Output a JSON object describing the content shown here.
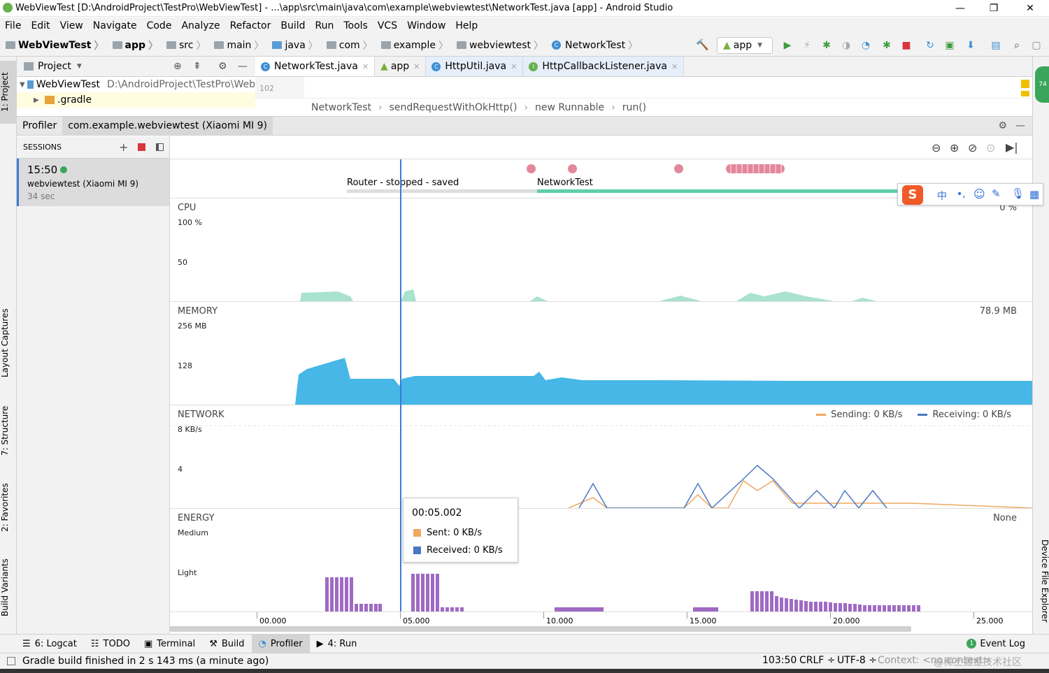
{
  "window": {
    "title": "WebViewTest [D:\\AndroidProject\\TestPro\\WebViewTest] - ...\\app\\src\\main\\java\\com\\example\\webviewtest\\NetworkTest.java [app] - Android Studio",
    "min": "—",
    "max": "❐",
    "close": "✕"
  },
  "menu": [
    "File",
    "Edit",
    "View",
    "Navigate",
    "Code",
    "Analyze",
    "Refactor",
    "Build",
    "Run",
    "Tools",
    "VCS",
    "Window",
    "Help"
  ],
  "breadcrumbs": [
    "WebViewTest",
    "app",
    "src",
    "main",
    "java",
    "com",
    "example",
    "webviewtest",
    "NetworkTest"
  ],
  "run_config": "app",
  "left_tabs": {
    "project": "1: Project",
    "layout_captures": "Layout Captures",
    "structure": "7: Structure",
    "favorites": "2: Favorites",
    "build_variants": "Build Variants"
  },
  "right_tabs": {
    "device_file_explorer": "Device File Explorer",
    "badge": "74"
  },
  "project_panel": {
    "title": "Project",
    "root": "WebViewTest",
    "root_path": "D:\\AndroidProject\\TestPro\\Web",
    "child": ".gradle"
  },
  "editor_tabs": [
    "NetworkTest.java",
    "app",
    "HttpUtil.java",
    "HttpCallbackListener.java"
  ],
  "editor": {
    "line_number": "102",
    "crumbs": [
      "NetworkTest",
      "sendRequestWithOkHttp()",
      "new Runnable",
      "run()"
    ]
  },
  "profiler": {
    "label": "Profiler",
    "process": "com.example.webviewtest (Xiaomi MI 9)"
  },
  "sessions": {
    "header": "SESSIONS",
    "time": "15:50",
    "device": "webviewtest (Xiaomi MI 9)",
    "duration": "34 sec"
  },
  "events": {
    "activity1": "Router - stopped - saved",
    "activity2": "NetworkTest"
  },
  "cpu": {
    "title": "CPU",
    "t100": "100 %",
    "t50": "50",
    "value": "0 %"
  },
  "memory": {
    "title": "MEMORY",
    "t256": "256 MB",
    "t128": "128",
    "value": "78.9 MB"
  },
  "network": {
    "title": "NETWORK",
    "t8": "8 KB/s",
    "t4": "4",
    "legend_send": "Sending: 0 KB/s",
    "legend_recv": "Receiving: 0 KB/s",
    "send_color": "#f0a860",
    "recv_color": "#4a78c2"
  },
  "energy": {
    "title": "ENERGY",
    "medium": "Medium",
    "light": "Light",
    "value": "None",
    "bar_color": "#9f6ac4"
  },
  "tooltip": {
    "time": "00:05.002",
    "sent": "Sent: 0 KB/s",
    "received": "Received: 0 KB/s"
  },
  "time_axis": [
    "00.000",
    "05.000",
    "10.000",
    "15.000",
    "20.000",
    "25.000"
  ],
  "bottom_tabs": [
    "6: Logcat",
    "TODO",
    "Terminal",
    "Build",
    "Profiler",
    "4: Run",
    "Event Log"
  ],
  "status": {
    "message": "Gradle build finished in 2 s 143 ms (a minute ago)",
    "pos": "103:50",
    "crlf": "CRLF ÷",
    "enc": "UTF-8 ÷",
    "context": "Context: <no context>",
    "watermark": "@稀土掘金技术社区"
  }
}
